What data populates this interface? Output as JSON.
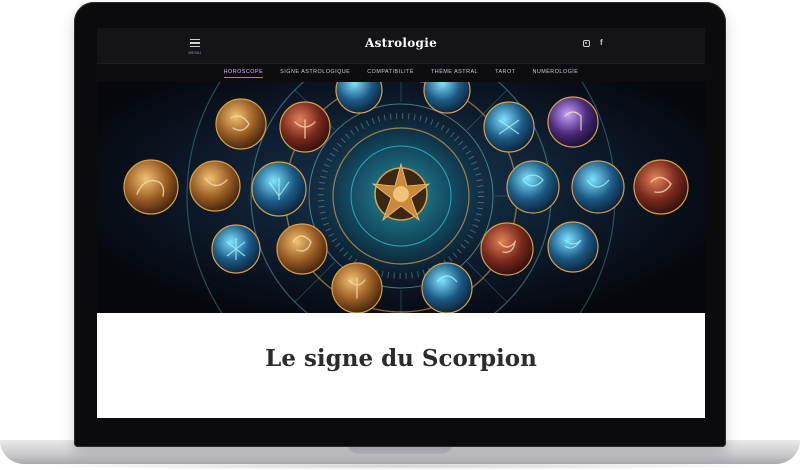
{
  "site": {
    "title": "Astrologie",
    "menu_label": "MENU",
    "social": [
      {
        "icon": "instagram-icon"
      },
      {
        "icon": "facebook-icon",
        "glyph": "f"
      }
    ]
  },
  "nav": {
    "items": [
      {
        "label": "HOROSCOPE",
        "active": true
      },
      {
        "label": "SIGNE ASTROLOGIQUE",
        "active": false
      },
      {
        "label": "COMPATIBILITÉ",
        "active": false
      },
      {
        "label": "THÈME ASTRAL",
        "active": false
      },
      {
        "label": "TAROT",
        "active": false
      },
      {
        "label": "NUMÉROLOGIE",
        "active": false
      }
    ]
  },
  "hero": {
    "image_name": "zodiac-wheel-illustration",
    "colors": {
      "accent": "#d7a24a",
      "glow": "#2fd7e0",
      "ring": "#6fb7c9"
    }
  },
  "content": {
    "heading": "Le signe du Scorpion"
  }
}
